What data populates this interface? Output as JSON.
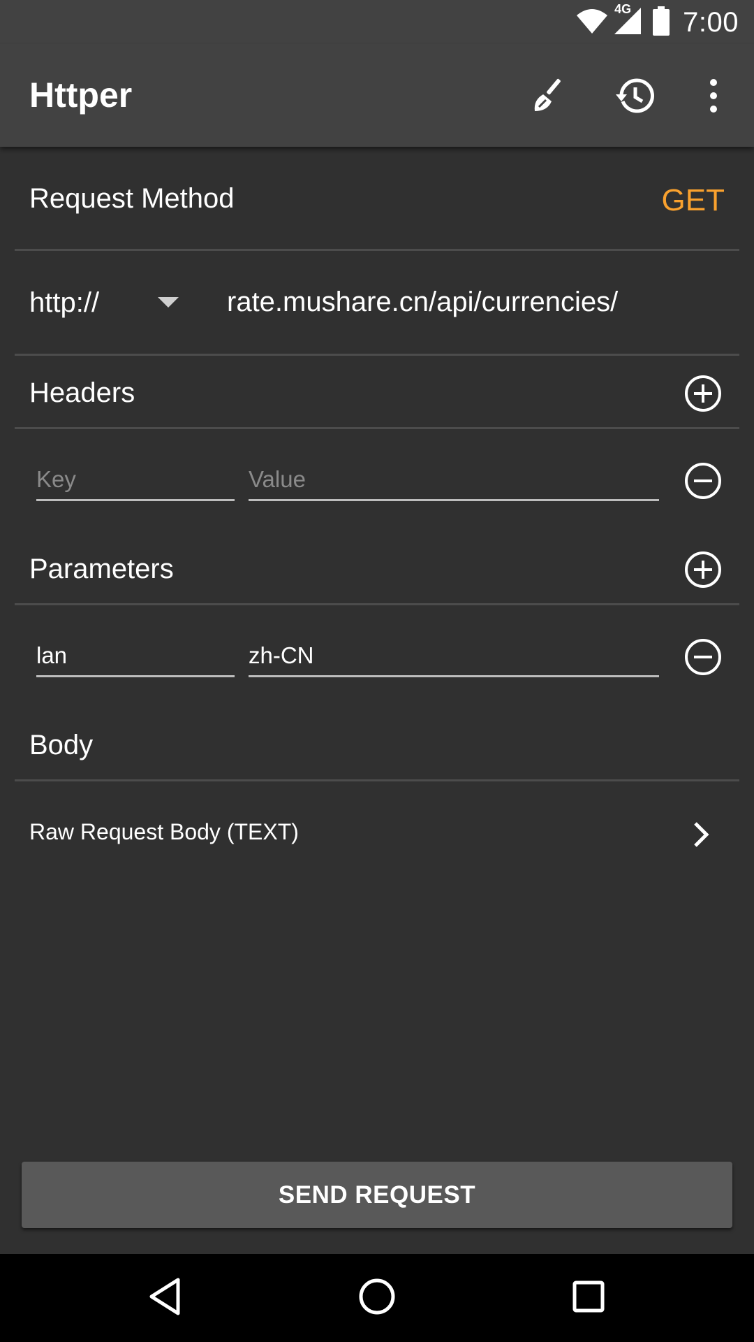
{
  "status_bar": {
    "time": "7:00",
    "network": "4G",
    "icons": [
      "wifi-icon",
      "signal-icon",
      "battery-icon"
    ]
  },
  "app_bar": {
    "title": "Httper",
    "actions": [
      "clear-icon",
      "history-icon",
      "more-vert-icon"
    ]
  },
  "request_method": {
    "label": "Request Method",
    "value": "GET",
    "value_color": "#f9a12e"
  },
  "url": {
    "scheme": "http://",
    "address": "rate.mushare.cn/api/currencies/"
  },
  "headers": {
    "title": "Headers",
    "rows": [
      {
        "key": "",
        "key_placeholder": "Key",
        "value": "",
        "value_placeholder": "Value"
      }
    ]
  },
  "parameters": {
    "title": "Parameters",
    "rows": [
      {
        "key": "lan",
        "value": "zh-CN"
      }
    ]
  },
  "body": {
    "title": "Body",
    "option_label": "Raw Request Body (TEXT)"
  },
  "send_button": {
    "label": "SEND REQUEST"
  },
  "colors": {
    "background": "#303030",
    "toolbar": "#424242",
    "accent": "#f9a12e",
    "button": "#595959"
  }
}
